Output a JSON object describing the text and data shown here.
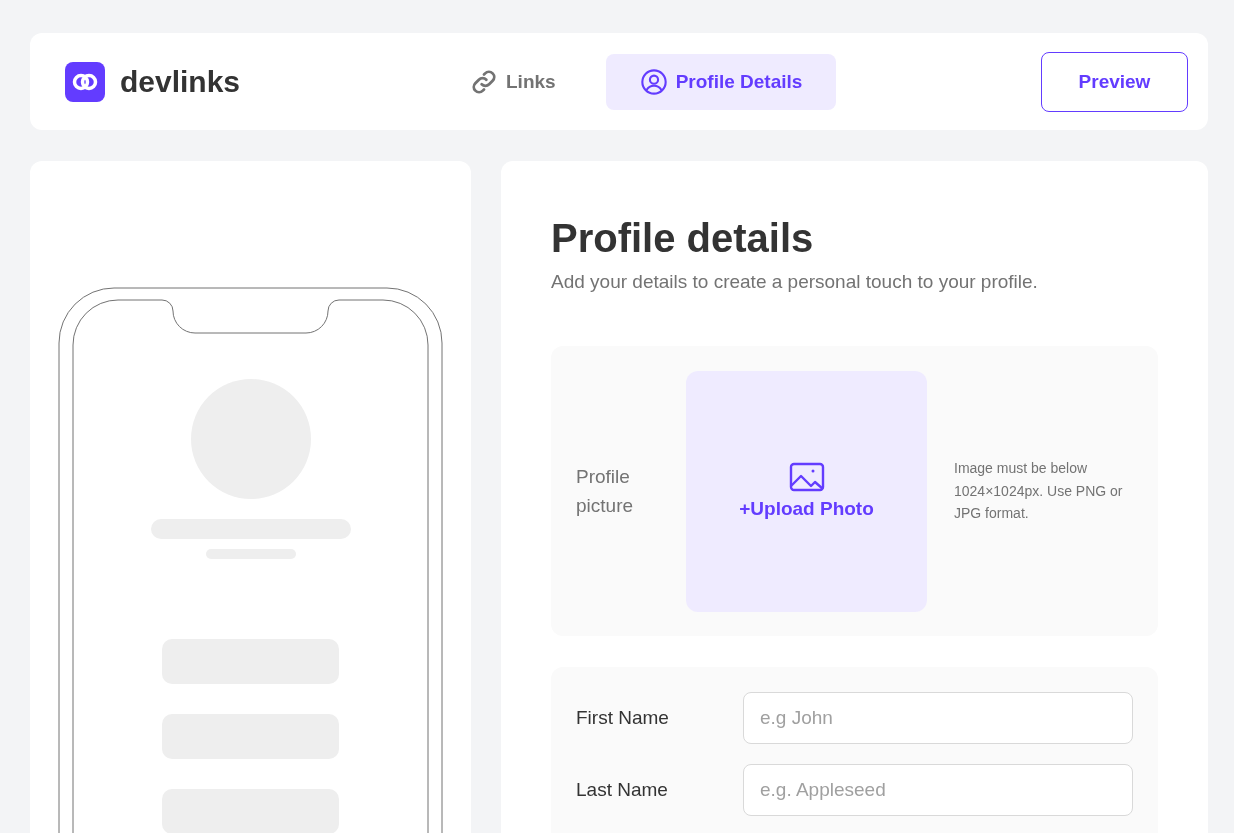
{
  "header": {
    "logo": "devlinks",
    "tabs": [
      {
        "label": "Links",
        "selected": false
      },
      {
        "label": "Profile Details",
        "selected": true
      }
    ],
    "preview_button": "Preview"
  },
  "profile": {
    "title": "Profile details",
    "subtitle": "Add your details to create a personal touch to your profile.",
    "picture": {
      "label": "Profile picture",
      "upload": "+Upload Photo",
      "hint": "Image must be below 1024×1024px. Use PNG or JPG format."
    },
    "fields": [
      {
        "label": "First Name",
        "placeholder": "e.g John"
      },
      {
        "label": "Last Name",
        "placeholder": "e.g. Appleseed"
      }
    ]
  }
}
